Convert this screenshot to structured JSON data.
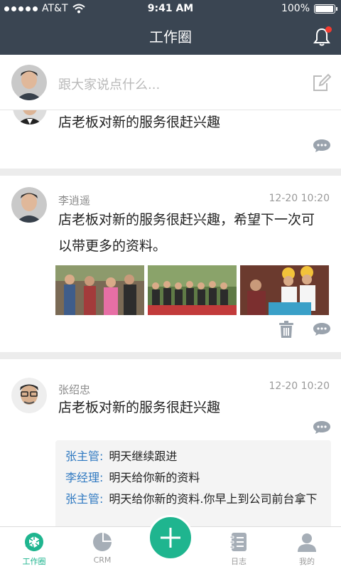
{
  "status": {
    "carrier": "AT&T",
    "time": "9:41 AM",
    "battery": "100%",
    "battery_level": 1.0
  },
  "header": {
    "title": "工作圈",
    "notification_unread": true
  },
  "composer": {
    "placeholder": "跟大家说点什么..."
  },
  "posts": [
    {
      "name": "",
      "time": "",
      "content": "店老板对新的服务很赶兴趣"
    },
    {
      "name": "李逍遥",
      "time": "12-20 10:20",
      "content": "店老板对新的服务很赶兴趣，希望下一次可以带更多的资料。",
      "photos": [
        "photo-1",
        "photo-2",
        "photo-3"
      ]
    },
    {
      "name": "张绍忠",
      "time": "12-20 10:20",
      "content": "店老板对新的服务很赶兴趣",
      "replies": [
        {
          "who": "张主管:",
          "msg": "明天继续跟进"
        },
        {
          "who": "李经理:",
          "msg": "明天给你新的资料"
        },
        {
          "who": "张主管:",
          "msg": "明天给你新的资料.你早上到公司前台拿下"
        }
      ]
    }
  ],
  "tabs": [
    {
      "label": "工作圈",
      "icon": "aperture-icon",
      "active": true
    },
    {
      "label": "CRM",
      "icon": "pie-chart-icon",
      "active": false
    },
    {
      "label": "日志",
      "icon": "notebook-icon",
      "active": false
    },
    {
      "label": "我的",
      "icon": "user-icon",
      "active": false
    }
  ],
  "colors": {
    "header_bg": "#3a4552",
    "accent": "#1fb58f",
    "link": "#2f79c1",
    "badge": "#f43b30"
  }
}
